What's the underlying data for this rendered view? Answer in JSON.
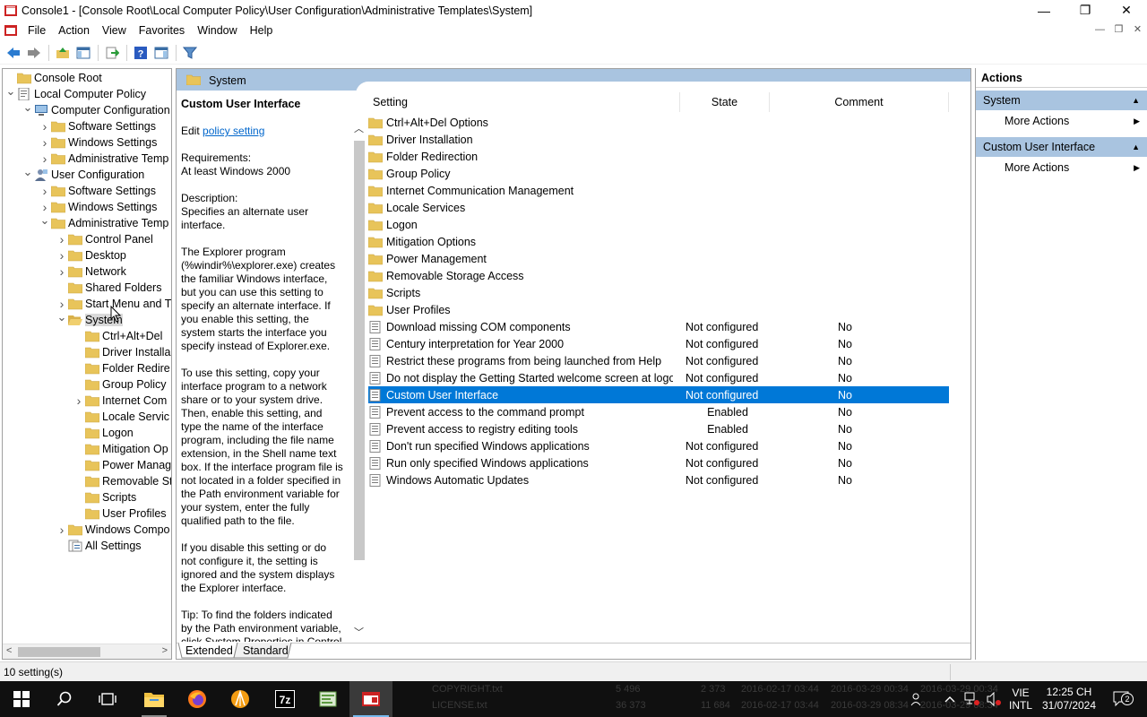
{
  "window": {
    "title": "Console1 - [Console Root\\Local Computer Policy\\User Configuration\\Administrative Templates\\System]",
    "minimize": "—",
    "maximize": "❐",
    "close": "✕"
  },
  "menu": {
    "items": [
      "File",
      "Action",
      "View",
      "Favorites",
      "Window",
      "Help"
    ]
  },
  "tree": {
    "nodes": [
      {
        "label": "Console Root",
        "level": 0,
        "arrow": "",
        "icon": "folder"
      },
      {
        "label": "Local Computer Policy",
        "level": 0,
        "arrow": "v",
        "icon": "policy"
      },
      {
        "label": "Computer Configuration",
        "level": 1,
        "arrow": "v",
        "icon": "computer"
      },
      {
        "label": "Software Settings",
        "level": 2,
        "arrow": ">",
        "icon": "folder"
      },
      {
        "label": "Windows Settings",
        "level": 2,
        "arrow": ">",
        "icon": "folder"
      },
      {
        "label": "Administrative Temp",
        "level": 2,
        "arrow": ">",
        "icon": "folder"
      },
      {
        "label": "User Configuration",
        "level": 1,
        "arrow": "v",
        "icon": "user"
      },
      {
        "label": "Software Settings",
        "level": 2,
        "arrow": ">",
        "icon": "folder"
      },
      {
        "label": "Windows Settings",
        "level": 2,
        "arrow": ">",
        "icon": "folder"
      },
      {
        "label": "Administrative Temp",
        "level": 2,
        "arrow": "v",
        "icon": "folder"
      },
      {
        "label": "Control Panel",
        "level": 3,
        "arrow": ">",
        "icon": "folder"
      },
      {
        "label": "Desktop",
        "level": 3,
        "arrow": ">",
        "icon": "folder"
      },
      {
        "label": "Network",
        "level": 3,
        "arrow": ">",
        "icon": "folder"
      },
      {
        "label": "Shared Folders",
        "level": 3,
        "arrow": "",
        "icon": "folder"
      },
      {
        "label": "Start Menu and T",
        "level": 3,
        "arrow": ">",
        "icon": "folder"
      },
      {
        "label": "System",
        "level": 3,
        "arrow": "v",
        "icon": "folder-open",
        "selected": true
      },
      {
        "label": "Ctrl+Alt+Del",
        "level": 4,
        "arrow": "",
        "icon": "folder"
      },
      {
        "label": "Driver Installa",
        "level": 4,
        "arrow": "",
        "icon": "folder"
      },
      {
        "label": "Folder Redire",
        "level": 4,
        "arrow": "",
        "icon": "folder"
      },
      {
        "label": "Group Policy",
        "level": 4,
        "arrow": "",
        "icon": "folder"
      },
      {
        "label": "Internet Com",
        "level": 4,
        "arrow": ">",
        "icon": "folder"
      },
      {
        "label": "Locale Servic",
        "level": 4,
        "arrow": "",
        "icon": "folder"
      },
      {
        "label": "Logon",
        "level": 4,
        "arrow": "",
        "icon": "folder"
      },
      {
        "label": "Mitigation Op",
        "level": 4,
        "arrow": "",
        "icon": "folder"
      },
      {
        "label": "Power Manag",
        "level": 4,
        "arrow": "",
        "icon": "folder"
      },
      {
        "label": "Removable St",
        "level": 4,
        "arrow": "",
        "icon": "folder"
      },
      {
        "label": "Scripts",
        "level": 4,
        "arrow": "",
        "icon": "folder"
      },
      {
        "label": "User Profiles",
        "level": 4,
        "arrow": "",
        "icon": "folder"
      },
      {
        "label": "Windows Compo",
        "level": 3,
        "arrow": ">",
        "icon": "folder"
      },
      {
        "label": "All Settings",
        "level": 3,
        "arrow": "",
        "icon": "allsettings"
      }
    ]
  },
  "center": {
    "header_title": "System",
    "description": {
      "title": "Custom User Interface",
      "edit_prefix": "Edit ",
      "edit_link": "policy setting",
      "body": "Requirements:\nAt least Windows 2000\n\nDescription:\nSpecifies an alternate user interface.\n\nThe Explorer program (%windir%\\explorer.exe) creates the familiar Windows interface, but you can use this setting to specify an alternate interface. If you enable this setting, the system starts the interface you specify instead of Explorer.exe.\n\nTo use this setting, copy your interface program to a network share or to your system drive. Then, enable this setting, and type the name of the interface program, including the file name extension, in the Shell name text box. If the interface program file is not located in a folder specified in the Path environment variable for your system, enter the fully qualified path to the file.\n\nIf you disable this setting or do not configure it, the setting is ignored and the system displays the Explorer interface.\n\nTip: To find the folders indicated by the Path environment variable, click System Properties in Control"
    },
    "columns": {
      "setting": "Setting",
      "state": "State",
      "comment": "Comment"
    },
    "rows": [
      {
        "name": "Ctrl+Alt+Del Options",
        "type": "folder",
        "state": "",
        "comment": ""
      },
      {
        "name": "Driver Installation",
        "type": "folder",
        "state": "",
        "comment": ""
      },
      {
        "name": "Folder Redirection",
        "type": "folder",
        "state": "",
        "comment": ""
      },
      {
        "name": "Group Policy",
        "type": "folder",
        "state": "",
        "comment": ""
      },
      {
        "name": "Internet Communication Management",
        "type": "folder",
        "state": "",
        "comment": ""
      },
      {
        "name": "Locale Services",
        "type": "folder",
        "state": "",
        "comment": ""
      },
      {
        "name": "Logon",
        "type": "folder",
        "state": "",
        "comment": ""
      },
      {
        "name": "Mitigation Options",
        "type": "folder",
        "state": "",
        "comment": ""
      },
      {
        "name": "Power Management",
        "type": "folder",
        "state": "",
        "comment": ""
      },
      {
        "name": "Removable Storage Access",
        "type": "folder",
        "state": "",
        "comment": ""
      },
      {
        "name": "Scripts",
        "type": "folder",
        "state": "",
        "comment": ""
      },
      {
        "name": "User Profiles",
        "type": "folder",
        "state": "",
        "comment": ""
      },
      {
        "name": "Download missing COM components",
        "type": "setting",
        "state": "Not configured",
        "comment": "No"
      },
      {
        "name": "Century interpretation for Year 2000",
        "type": "setting",
        "state": "Not configured",
        "comment": "No"
      },
      {
        "name": "Restrict these programs from being launched from Help",
        "type": "setting",
        "state": "Not configured",
        "comment": "No"
      },
      {
        "name": "Do not display the Getting Started welcome screen at logon",
        "type": "setting",
        "state": "Not configured",
        "comment": "No"
      },
      {
        "name": "Custom User Interface",
        "type": "setting",
        "state": "Not configured",
        "comment": "No",
        "selected": true
      },
      {
        "name": "Prevent access to the command prompt",
        "type": "setting",
        "state": "Enabled",
        "comment": "No"
      },
      {
        "name": "Prevent access to registry editing tools",
        "type": "setting",
        "state": "Enabled",
        "comment": "No"
      },
      {
        "name": "Don't run specified Windows applications",
        "type": "setting",
        "state": "Not configured",
        "comment": "No"
      },
      {
        "name": "Run only specified Windows applications",
        "type": "setting",
        "state": "Not configured",
        "comment": "No"
      },
      {
        "name": "Windows Automatic Updates",
        "type": "setting",
        "state": "Not configured",
        "comment": "No"
      }
    ],
    "tabs": {
      "extended": "Extended",
      "standard": "Standard"
    }
  },
  "actions": {
    "title": "Actions",
    "sections": [
      {
        "label": "System",
        "item": "More Actions"
      },
      {
        "label": "Custom User Interface",
        "item": "More Actions"
      }
    ]
  },
  "status": {
    "text": "10 setting(s)"
  },
  "taskbar": {
    "lang_top": "VIE",
    "lang_bottom": "INTL",
    "time": "12:25 CH",
    "date": "31/07/2024",
    "notif_count": "2",
    "ghost_rows": [
      [
        "COPYRIGHT.txt",
        "5 496",
        "2 373",
        "2016-02-17 03:44",
        "2016-03-29 00:34",
        "2016-03-29 00:34"
      ],
      [
        "LICENSE.txt",
        "36 373",
        "11 684",
        "2016-02-17 03:44",
        "2016-03-29 08:34",
        "2016-03-29 08:34"
      ]
    ]
  },
  "colors": {
    "header_blue": "#a9c4e0",
    "selection_blue": "#0078d7",
    "folder_yellow": "#e8c45a",
    "link_blue": "#0066cc",
    "taskbar_bg": "#101010"
  }
}
